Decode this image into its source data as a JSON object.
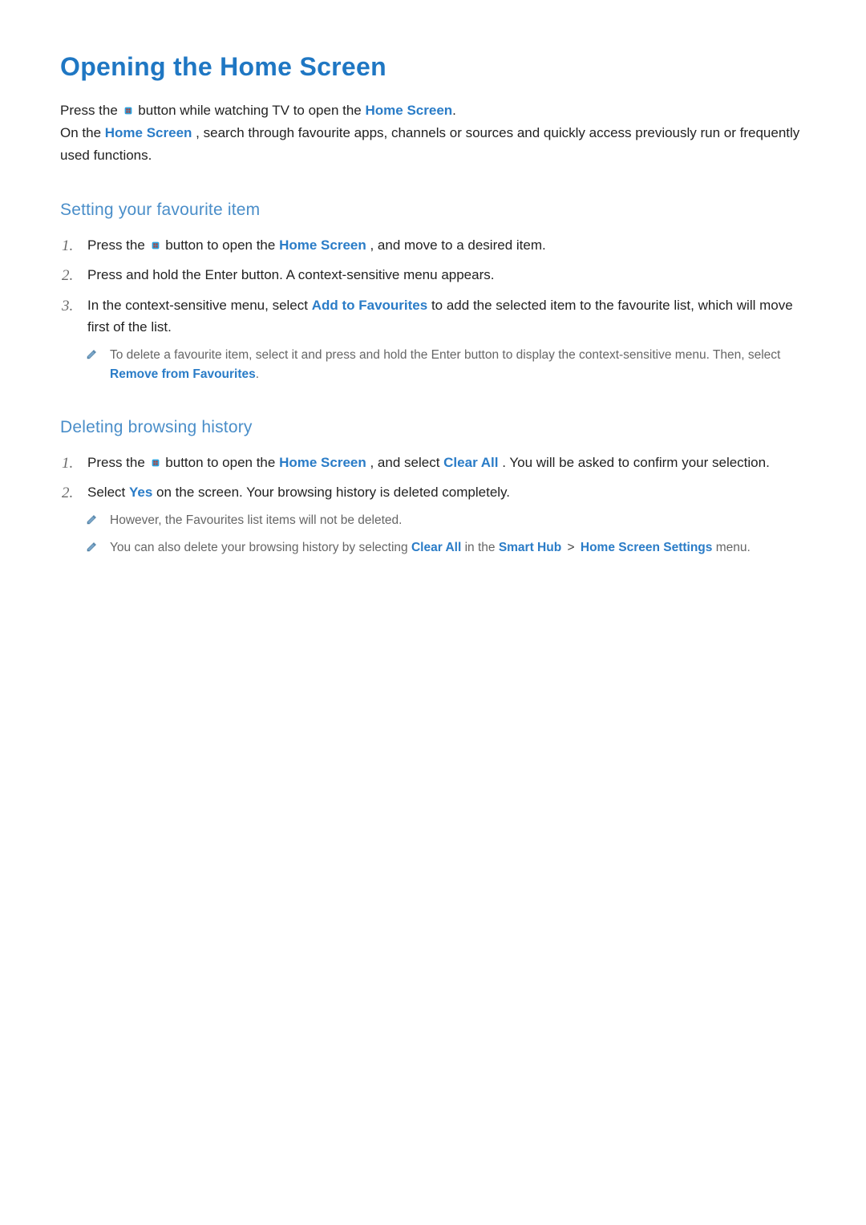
{
  "title": "Opening the Home Screen",
  "intro": {
    "p1a": "Press the ",
    "p1b": " button while watching TV to open the ",
    "p1_link": "Home Screen",
    "p1c": ".",
    "p2a": "On the ",
    "p2_link": "Home Screen",
    "p2b": ", search through favourite apps, channels or sources and quickly access previously run or frequently used functions."
  },
  "section1": {
    "title": "Setting your favourite item",
    "steps": [
      {
        "a": "Press the ",
        "b": " button to open the ",
        "link": "Home Screen",
        "c": ", and move to a desired item."
      },
      {
        "text": "Press and hold the Enter button. A context-sensitive menu appears."
      },
      {
        "a": "In the context-sensitive menu, select ",
        "link": "Add to Favourites",
        "b": " to add the selected item to the favourite list, which will move first of the list."
      }
    ],
    "note": {
      "a": "To delete a favourite item, select it and press and hold the Enter button to display the context-sensitive menu. Then, select ",
      "link": "Remove from Favourites",
      "b": "."
    }
  },
  "section2": {
    "title": "Deleting browsing history",
    "steps": [
      {
        "a": "Press the ",
        "b": " button to open the ",
        "link1": "Home Screen",
        "c": ", and select ",
        "link2": "Clear All",
        "d": ". You will be asked to confirm your selection."
      },
      {
        "a": "Select ",
        "link": "Yes",
        "b": " on the screen. Your browsing history is deleted completely."
      }
    ],
    "notes": [
      {
        "text": "However, the Favourites list items will not be deleted."
      },
      {
        "a": "You can also delete your browsing history by selecting ",
        "link1": "Clear All",
        "b": " in the ",
        "link2": "Smart Hub",
        "sep": ">",
        "link3": "Home Screen Settings",
        "c": " menu."
      }
    ]
  },
  "icons": {
    "smart_hub": "smart-hub-icon",
    "note": "note-pencil-icon"
  },
  "colors": {
    "heading": "#1f77c3",
    "subheading": "#4a8ec9",
    "link": "#2a7cc7",
    "body": "#222222",
    "muted": "#666666"
  }
}
